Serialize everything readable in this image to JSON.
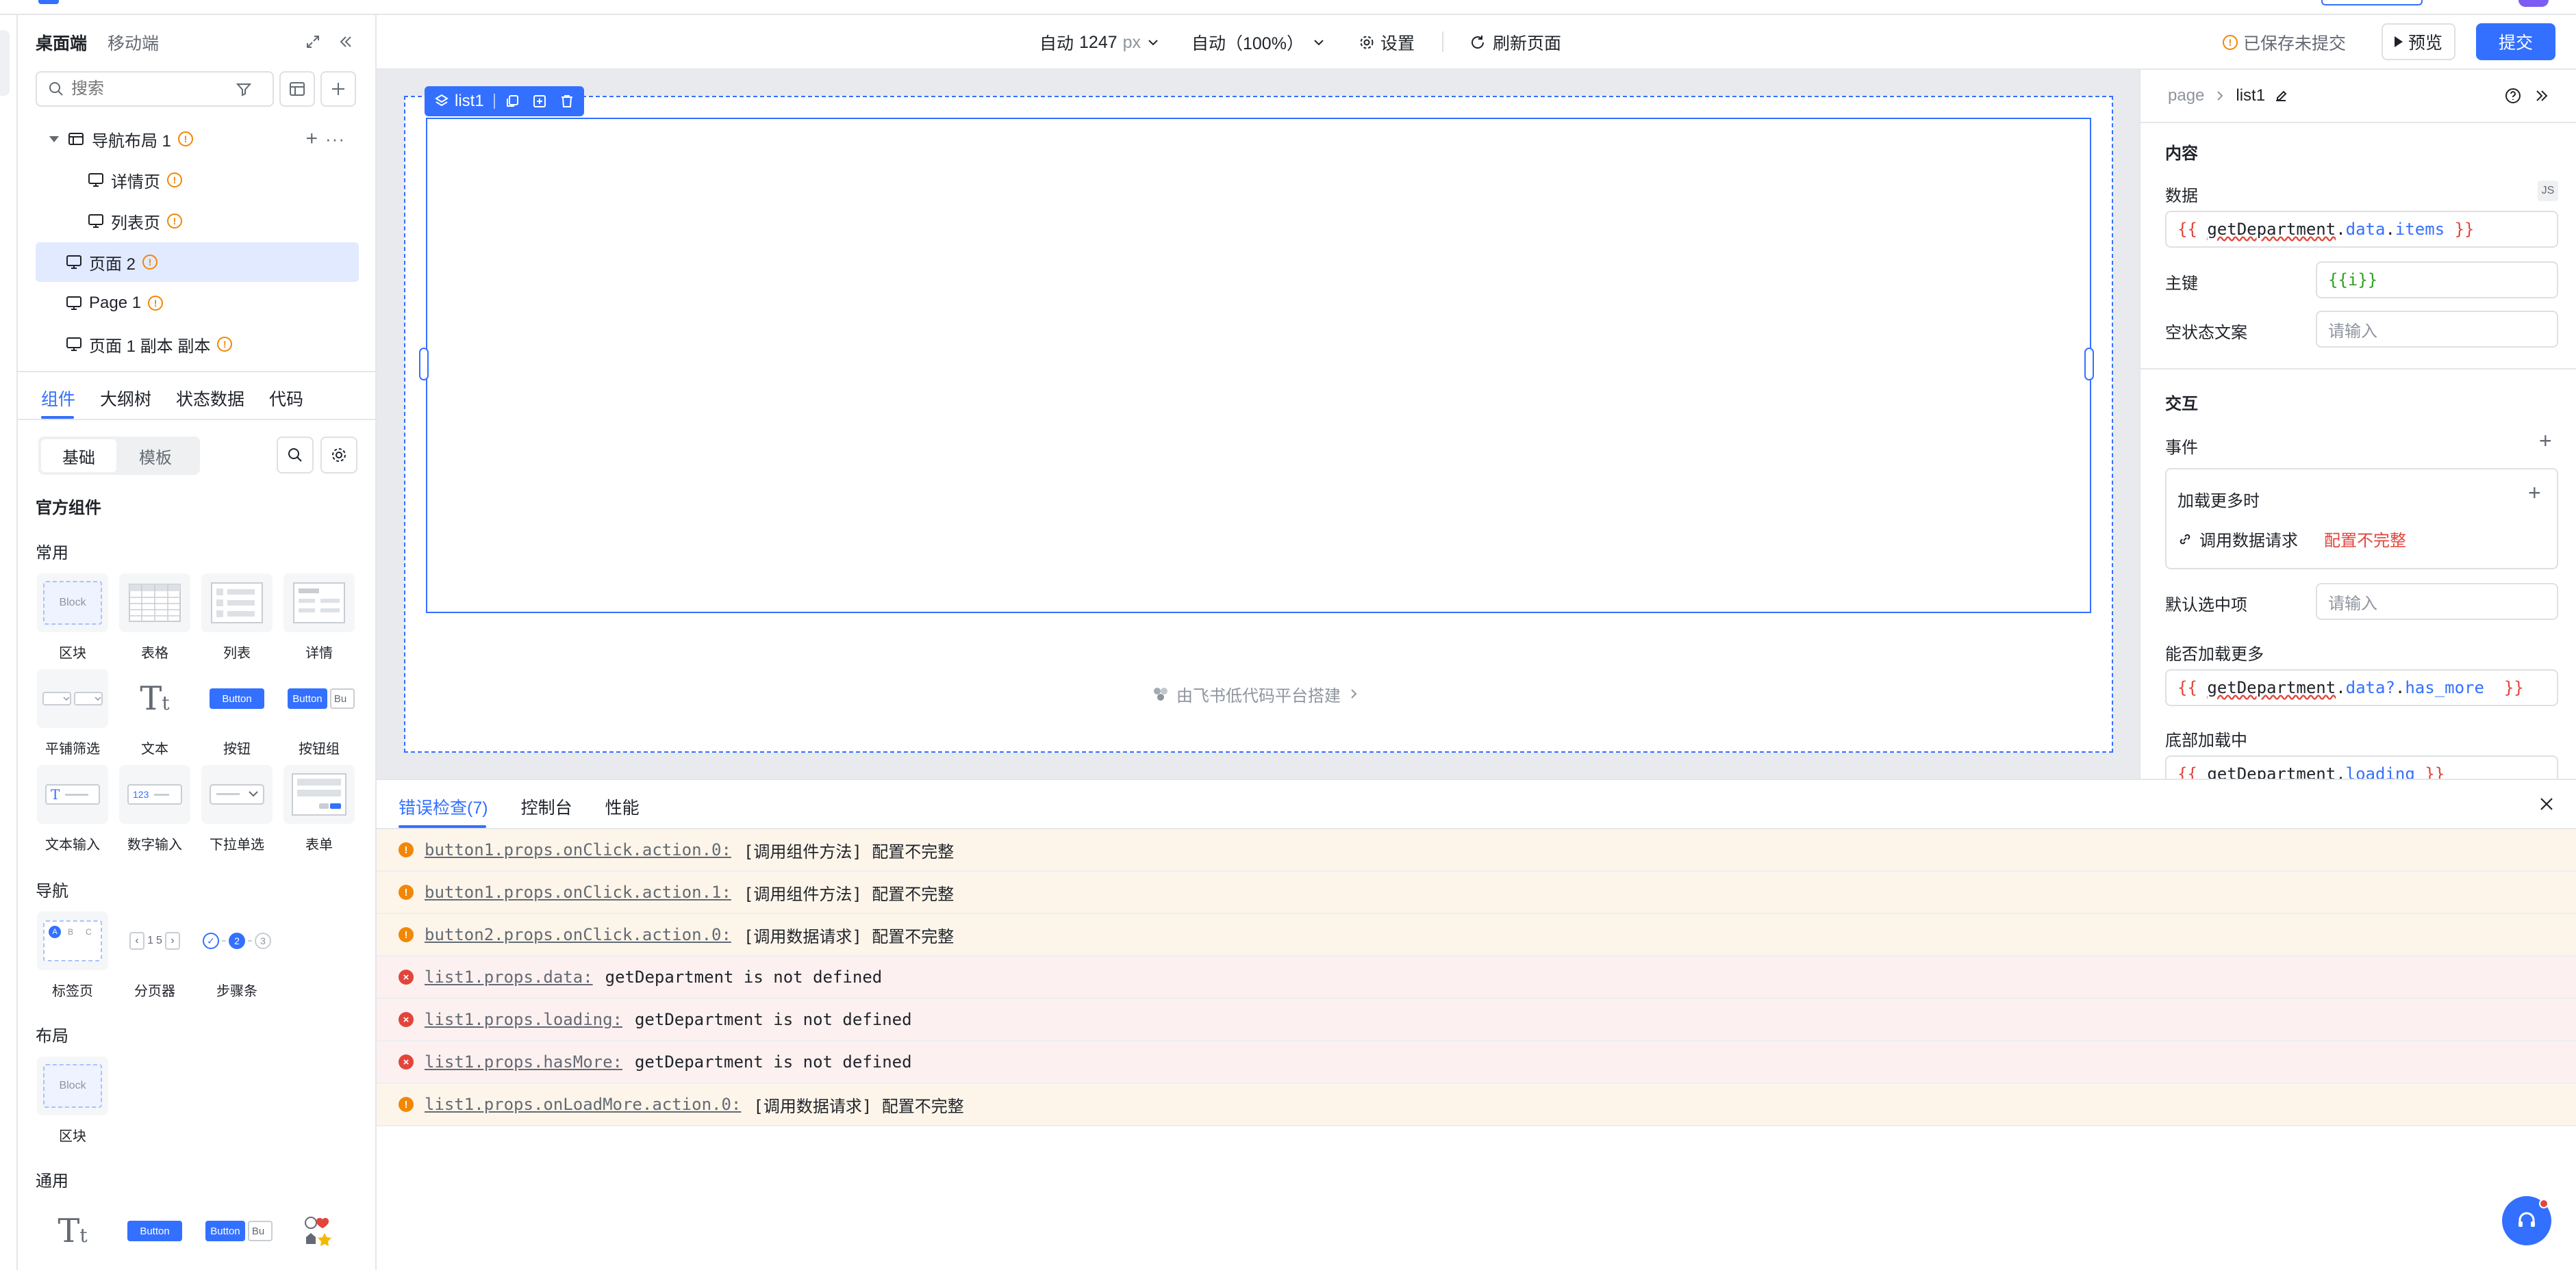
{
  "sidebar": {
    "mode_tabs": [
      "桌面端",
      "移动端"
    ],
    "search_placeholder": "搜索",
    "pages": [
      {
        "label": "导航布局 1",
        "level": 0,
        "expanded": true
      },
      {
        "label": "详情页",
        "level": 1
      },
      {
        "label": "列表页",
        "level": 1
      },
      {
        "label": "页面 2",
        "level": 0,
        "selected": true
      },
      {
        "label": "Page 1",
        "level": 0
      },
      {
        "label": "页面 1 副本 副本",
        "level": 0
      }
    ],
    "panel_tabs": [
      "组件",
      "大纲树",
      "状态数据",
      "代码"
    ],
    "lib_tabs": [
      "基础",
      "模板"
    ],
    "official_title": "官方组件",
    "groups": {
      "common": "常用",
      "nav": "导航",
      "layout": "布局",
      "general": "通用"
    },
    "components_common": [
      "区块",
      "表格",
      "列表",
      "详情",
      "平铺筛选",
      "文本",
      "按钮",
      "按钮组",
      "文本输入",
      "数字输入",
      "下拉单选",
      "表单"
    ],
    "components_nav": [
      "标签页",
      "分页器",
      "步骤条"
    ],
    "components_layout": [
      "区块"
    ],
    "thumb_text": {
      "block": "Block",
      "button": "Button",
      "button_short": "Bu",
      "number": "123",
      "tabs": [
        "A",
        "B",
        "C"
      ],
      "pager": [
        "1",
        "5"
      ],
      "steps": [
        "2",
        "3"
      ]
    }
  },
  "toolbar": {
    "width_mode": "自动",
    "width_value": "1247",
    "width_unit": "px",
    "zoom": "自动（100%）",
    "settings": "设置",
    "refresh": "刷新页面",
    "saved_status": "已保存未提交",
    "preview": "预览",
    "submit": "提交"
  },
  "canvas": {
    "component_tag": "list1",
    "footer": "由飞书低代码平台搭建"
  },
  "props": {
    "breadcrumb": [
      "page",
      "list1"
    ],
    "section_content": "内容",
    "data_label": "数据",
    "js_badge": "JS",
    "data_value": [
      "{{ ",
      "getDepartment",
      ".",
      "data",
      ".",
      "items",
      " }}"
    ],
    "key_label": "主键",
    "key_value": "{{i}}",
    "empty_label": "空状态文案",
    "empty_placeholder": "请输入",
    "section_interaction": "交互",
    "events_label": "事件",
    "event_name": "加载更多时",
    "event_action": "调用数据请求",
    "event_status": "配置不完整",
    "default_selected_label": "默认选中项",
    "default_selected_placeholder": "请输入",
    "has_more_label": "能否加载更多",
    "has_more_value": [
      "{{ ",
      "getDepartment",
      ".",
      "data?",
      ".",
      "has_more",
      "  }}"
    ],
    "loading_label": "底部加载中",
    "loading_value": [
      "{{ ",
      "getDepartment",
      ".",
      "loading",
      " }}"
    ]
  },
  "bottom": {
    "tabs": [
      "错误检查(7)",
      "控制台",
      "性能"
    ],
    "errors": [
      {
        "level": "warn",
        "path": "button1.props.onClick.action.0:",
        "msg": "[调用组件方法] 配置不完整"
      },
      {
        "level": "warn",
        "path": "button1.props.onClick.action.1:",
        "msg": "[调用组件方法] 配置不完整"
      },
      {
        "level": "warn",
        "path": "button2.props.onClick.action.0:",
        "msg": "[调用数据请求] 配置不完整"
      },
      {
        "level": "error",
        "path": "list1.props.data:",
        "msg": "getDepartment is not defined"
      },
      {
        "level": "error",
        "path": "list1.props.loading:",
        "msg": "getDepartment is not defined"
      },
      {
        "level": "error",
        "path": "list1.props.hasMore:",
        "msg": "getDepartment is not defined"
      },
      {
        "level": "warn",
        "path": "list1.props.onLoadMore.action.0:",
        "msg": "[调用数据请求] 配置不完整"
      }
    ]
  },
  "colors": {
    "accent": "#3370ff",
    "warn": "#f28705",
    "error": "#e2453b"
  }
}
